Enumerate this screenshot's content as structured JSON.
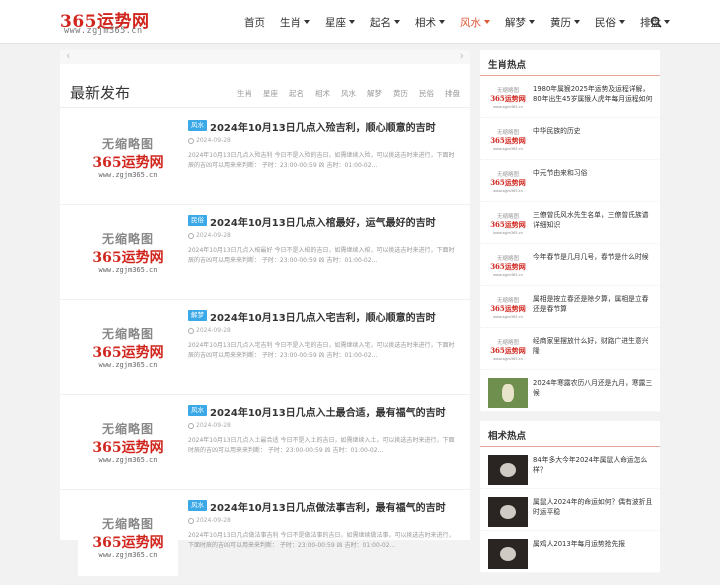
{
  "header": {
    "logo_main": "365运势网",
    "logo_sub": "www.zgjm365.cn",
    "nav": [
      {
        "label": "首页",
        "dropdown": false,
        "active": false
      },
      {
        "label": "生肖",
        "dropdown": true,
        "active": false
      },
      {
        "label": "星座",
        "dropdown": true,
        "active": false
      },
      {
        "label": "起名",
        "dropdown": true,
        "active": false
      },
      {
        "label": "相术",
        "dropdown": true,
        "active": false
      },
      {
        "label": "风水",
        "dropdown": true,
        "active": true
      },
      {
        "label": "解梦",
        "dropdown": true,
        "active": false
      },
      {
        "label": "黄历",
        "dropdown": true,
        "active": false
      },
      {
        "label": "民俗",
        "dropdown": true,
        "active": false
      },
      {
        "label": "排盘",
        "dropdown": true,
        "active": false
      }
    ],
    "search_icon": "search-icon"
  },
  "main": {
    "slider": {
      "prev": "‹",
      "next": "›"
    },
    "section_title": "最新发布",
    "categories": [
      "生肖",
      "星座",
      "起名",
      "相术",
      "风水",
      "解梦",
      "黄历",
      "民俗",
      "排盘"
    ],
    "thumb_placeholder": {
      "line1": "无缩略图",
      "line2": "365运势网",
      "line3": "www.zgjm365.cn"
    },
    "posts": [
      {
        "tag": "风水",
        "title": "2024年10月13日几点入殓吉利，顺心顺意的吉时",
        "date": "2024-09-28",
        "excerpt": "2024年10月13日几点入殓吉利 今日不是入殓的吉日，如需继续入殓，可以挑选吉时来进行，下面时辰的吉凶可以用来来判断： 子时：23:00-00:59 凶 吉时：01:00-02..."
      },
      {
        "tag": "民俗",
        "title": "2024年10月13日几点入棺最好，运气最好的吉时",
        "date": "2024-09-28",
        "excerpt": "2024年10月13日几点入棺最好 今日不是入棺的吉日，如需继续入棺，可以挑选吉时来进行，下面时辰的吉凶可以用来来判断： 子时：23:00-00:59 凶 吉时：01:00-02..."
      },
      {
        "tag": "解梦",
        "title": "2024年10月13日几点入宅吉利，顺心顺意的吉时",
        "date": "2024-09-28",
        "excerpt": "2024年10月13日几点入宅吉利 今日不是入宅的吉日，如需继续入宅，可以挑选吉时来进行，下面时辰的吉凶可以用来来判断： 子时：23:00-00:59 凶 吉时：01:00-02..."
      },
      {
        "tag": "风水",
        "title": "2024年10月13日几点入土最合适，最有福气的吉时",
        "date": "2024-09-28",
        "excerpt": "2024年10月13日几点入土最合适 今日不是入土的吉日，如需继续入土，可以挑选吉时来进行，下面时辰的吉凶可以用来来判断： 子时：23:00-00:59 凶 吉时：01:00-02..."
      },
      {
        "tag": "风水",
        "title": "2024年10月13日几点做法事吉利，最有福气的吉时",
        "date": "2024-09-28",
        "excerpt": "2024年10月13日几点做法事吉利 今日不是做法事的吉日，如需继续做法事，可以挑选吉时来进行，下面时辰的吉凶可以用来来判断： 子时：23:00-00:59 凶 吉时：01:00-02..."
      }
    ]
  },
  "sidebar": {
    "thumb_placeholder": {
      "line1": "无缩略图",
      "line2": "365运势网",
      "line3": "www.zgjm365.cn"
    },
    "widgets": [
      {
        "title": "生肖热点",
        "items": [
          {
            "text": "1980年属猴2025年运势及运程详解，80年出生45岁属猴人虎年每月运程如何",
            "thumb": "placeholder"
          },
          {
            "text": "中华民族的历史",
            "thumb": "placeholder"
          },
          {
            "text": "中元节由来和习俗",
            "thumb": "placeholder"
          },
          {
            "text": "三僚曾氏风水先生名单，三僚曾氏族谱详细知识",
            "thumb": "placeholder"
          },
          {
            "text": "今年春节是几月几号，春节是什么时候",
            "thumb": "placeholder"
          },
          {
            "text": "属相是按立春还是除夕算，属相是立春还是春节算",
            "thumb": "placeholder"
          },
          {
            "text": "经商家里摆放什么好，财路广进生意兴隆",
            "thumb": "placeholder"
          },
          {
            "text": "2024年寒露农历八月还是九月，寒露三候",
            "thumb": "photo"
          }
        ]
      },
      {
        "title": "相术热点",
        "items": [
          {
            "text": "84年多大今年2024年属鼠人命运怎么样？",
            "thumb": "photo-dark"
          },
          {
            "text": "属鼠人2024年的命运如何？偶有波折且时运平稳",
            "thumb": "photo-dark"
          },
          {
            "text": "属鸡人2013年每月运势抢先报",
            "thumb": "photo-dark"
          }
        ]
      }
    ]
  }
}
